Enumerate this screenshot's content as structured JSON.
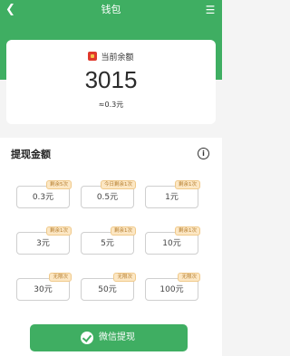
{
  "header": {
    "title": "钱包",
    "back_icon": "chevron-left-icon",
    "menu_icon": "menu-icon"
  },
  "balance": {
    "label": "当前余额",
    "amount": "3015",
    "sub": "≈0.3元",
    "icon": "red-packet-icon"
  },
  "withdraw": {
    "section_title": "提现金额",
    "info_icon": "i",
    "options": [
      {
        "amount": "0.3元",
        "badge": "剩余5次"
      },
      {
        "amount": "0.5元",
        "badge": "今日剩余1次"
      },
      {
        "amount": "1元",
        "badge": "剩余1次"
      },
      {
        "amount": "3元",
        "badge": "剩余1次"
      },
      {
        "amount": "5元",
        "badge": "剩余1次"
      },
      {
        "amount": "10元",
        "badge": "剩余1次"
      },
      {
        "amount": "30元",
        "badge": "无限次"
      },
      {
        "amount": "50元",
        "badge": "无限次"
      },
      {
        "amount": "100元",
        "badge": "无限次"
      }
    ],
    "button_label": "微信提现"
  },
  "colors": {
    "brand": "#3fae62",
    "badge_bg": "#fce7c4",
    "badge_text": "#b37a2a"
  }
}
